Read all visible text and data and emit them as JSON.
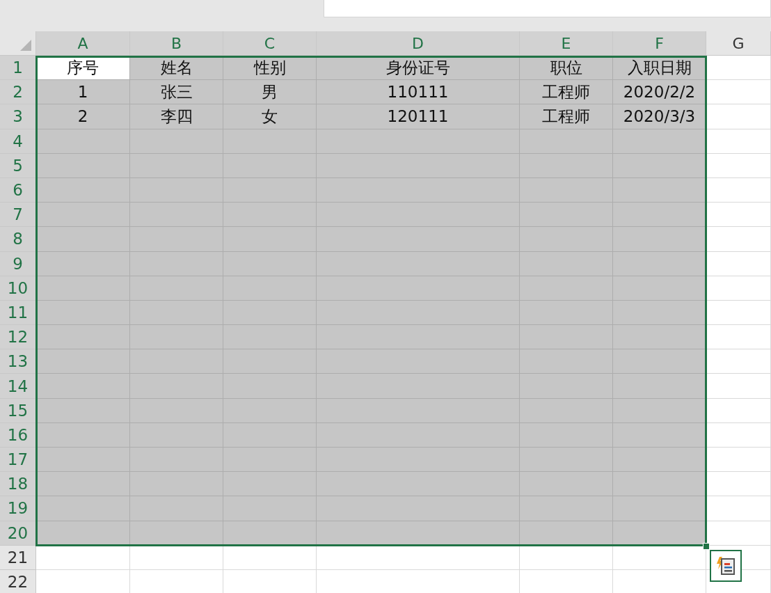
{
  "columns": [
    {
      "label": "A",
      "selected": true
    },
    {
      "label": "B",
      "selected": true
    },
    {
      "label": "C",
      "selected": true
    },
    {
      "label": "D",
      "selected": true
    },
    {
      "label": "E",
      "selected": true
    },
    {
      "label": "F",
      "selected": true
    },
    {
      "label": "G",
      "selected": false
    }
  ],
  "rows": [
    {
      "label": "1",
      "selected": true,
      "cells": [
        {
          "text": "序号",
          "active": true
        },
        {
          "text": "姓名",
          "active": false
        },
        {
          "text": "性别",
          "active": false
        },
        {
          "text": "身份证号",
          "active": false
        },
        {
          "text": "职位",
          "active": false
        },
        {
          "text": "入职日期",
          "active": false
        }
      ]
    },
    {
      "label": "2",
      "selected": true,
      "cells": [
        {
          "text": "1",
          "active": false
        },
        {
          "text": "张三",
          "active": false
        },
        {
          "text": "男",
          "active": false
        },
        {
          "text": "110111",
          "active": false
        },
        {
          "text": "工程师",
          "active": false
        },
        {
          "text": "2020/2/2",
          "active": false
        }
      ]
    },
    {
      "label": "3",
      "selected": true,
      "cells": [
        {
          "text": "2",
          "active": false
        },
        {
          "text": "李四",
          "active": false
        },
        {
          "text": "女",
          "active": false
        },
        {
          "text": "120111",
          "active": false
        },
        {
          "text": "工程师",
          "active": false
        },
        {
          "text": "2020/3/3",
          "active": false
        }
      ]
    },
    {
      "label": "4",
      "selected": true
    },
    {
      "label": "5",
      "selected": true
    },
    {
      "label": "6",
      "selected": true
    },
    {
      "label": "7",
      "selected": true
    },
    {
      "label": "8",
      "selected": true
    },
    {
      "label": "9",
      "selected": true
    },
    {
      "label": "10",
      "selected": true
    },
    {
      "label": "11",
      "selected": true
    },
    {
      "label": "12",
      "selected": true
    },
    {
      "label": "13",
      "selected": true
    },
    {
      "label": "14",
      "selected": true
    },
    {
      "label": "15",
      "selected": true
    },
    {
      "label": "16",
      "selected": true
    },
    {
      "label": "17",
      "selected": true
    },
    {
      "label": "18",
      "selected": true
    },
    {
      "label": "19",
      "selected": true
    },
    {
      "label": "20",
      "selected": true
    },
    {
      "label": "21",
      "selected": false
    },
    {
      "label": "22",
      "selected": false
    }
  ]
}
